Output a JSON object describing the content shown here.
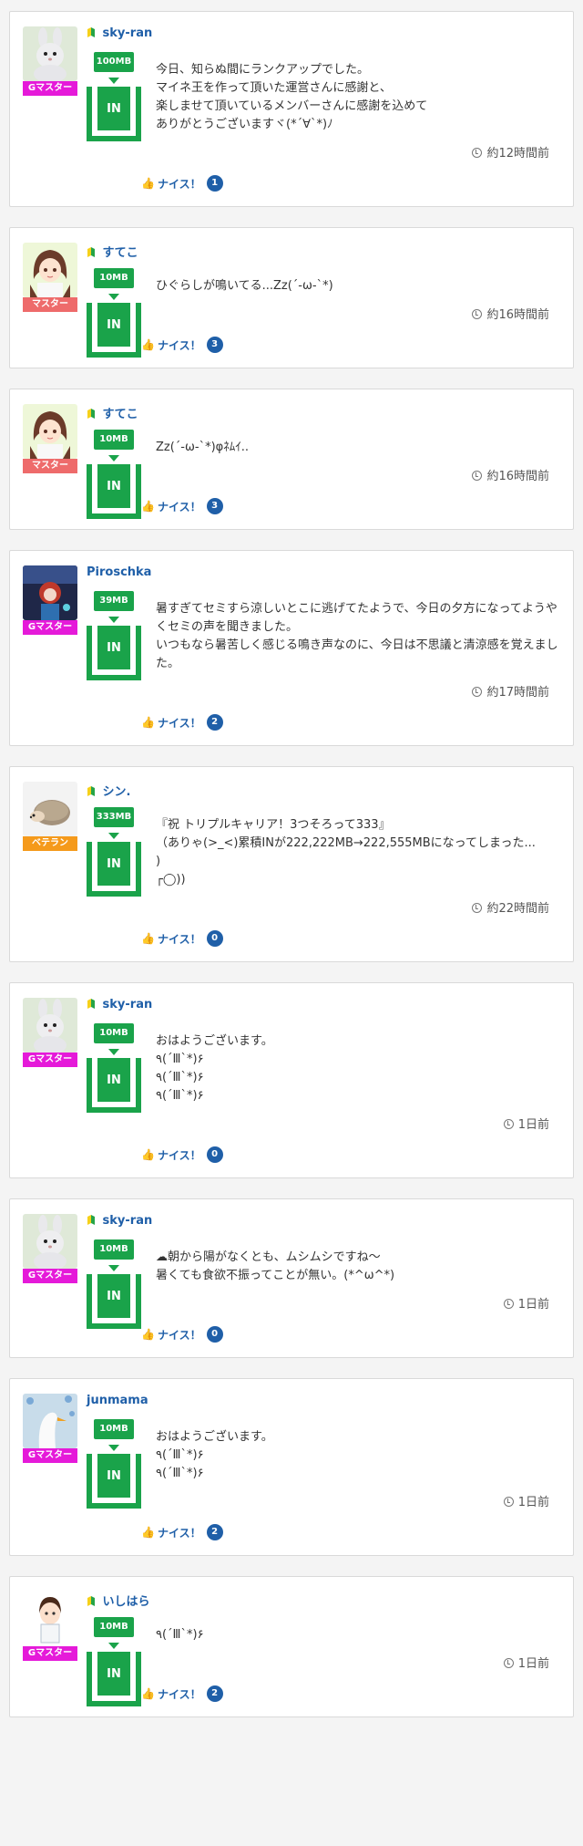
{
  "ui": {
    "nice_label": "ナイス！",
    "in_label": "IN",
    "rank_colors": {
      "Gマスター": "#e51ad9",
      "マスター": "#ee6b6b",
      "ベテラン": "#f59a1b"
    }
  },
  "posts": [
    {
      "user": "sky-ran",
      "beginner": true,
      "avatar": "bunny",
      "rank": "Gマスター",
      "mb": "100MB",
      "message": "今日、知らぬ間にランクアップでした。\nマイネ王を作って頂いた運営さんに感謝と、\n楽しませて頂いているメンバーさんに感謝を込めて\nありがとうございますヾ(*´∀`*)ﾉ",
      "time": "約12時間前",
      "nice": "1"
    },
    {
      "user": "すてこ",
      "beginner": true,
      "avatar": "girl",
      "rank": "マスター",
      "mb": "10MB",
      "message": "ひぐらしが鳴いてる...Zz(´-ω-`*)",
      "time": "約16時間前",
      "nice": "3"
    },
    {
      "user": "すてこ",
      "beginner": true,
      "avatar": "girl",
      "rank": "マスター",
      "mb": "10MB",
      "message": "Zz(´-ω-`*)φﾈﾑｲ..",
      "time": "約16時間前",
      "nice": "3"
    },
    {
      "user": "Piroschka",
      "beginner": false,
      "avatar": "dark",
      "rank": "Gマスター",
      "mb": "39MB",
      "message": "暑すぎてセミすら涼しいとこに逃げてたようで、今日の夕方になってようやくセミの声を聞きました。\nいつもなら暑苦しく感じる鳴き声なのに、今日は不思議と清涼感を覚えました。",
      "time": "約17時間前",
      "nice": "2"
    },
    {
      "user": "シン.",
      "beginner": true,
      "avatar": "hog",
      "rank": "ベテラン",
      "mb": "333MB",
      "message": "『祝 トリプルキャリア！3つそろって333』\n（ありゃ(>_<)累積INが222,222MB→222,555MBになってしまった...\n)\n┌◯))",
      "time": "約22時間前",
      "nice": "0"
    },
    {
      "user": "sky-ran",
      "beginner": true,
      "avatar": "bunny",
      "rank": "Gマスター",
      "mb": "10MB",
      "message": "おはようございます。\n٩(´Ⅲ`*)۶\n٩(´Ⅲ`*)۶\n٩(´Ⅲ`*)۶",
      "time": "1日前",
      "nice": "0"
    },
    {
      "user": "sky-ran",
      "beginner": true,
      "avatar": "bunny",
      "rank": "Gマスター",
      "mb": "10MB",
      "message": "☁朝から陽がなくとも、ムシムシですね〜\n暑くても食欲不振ってことが無い。(*^ω^*)",
      "time": "1日前",
      "nice": "0"
    },
    {
      "user": "junmama",
      "beginner": false,
      "avatar": "swan",
      "rank": "Gマスター",
      "mb": "10MB",
      "message": "おはようございます。\n٩(´Ⅲ`*)۶\n٩(´Ⅲ`*)۶",
      "time": "1日前",
      "nice": "2"
    },
    {
      "user": "いしはら",
      "beginner": true,
      "avatar": "boy",
      "rank": "Gマスター",
      "mb": "10MB",
      "message": "٩(´Ⅲ`*)۶",
      "time": "1日前",
      "nice": "2"
    }
  ]
}
